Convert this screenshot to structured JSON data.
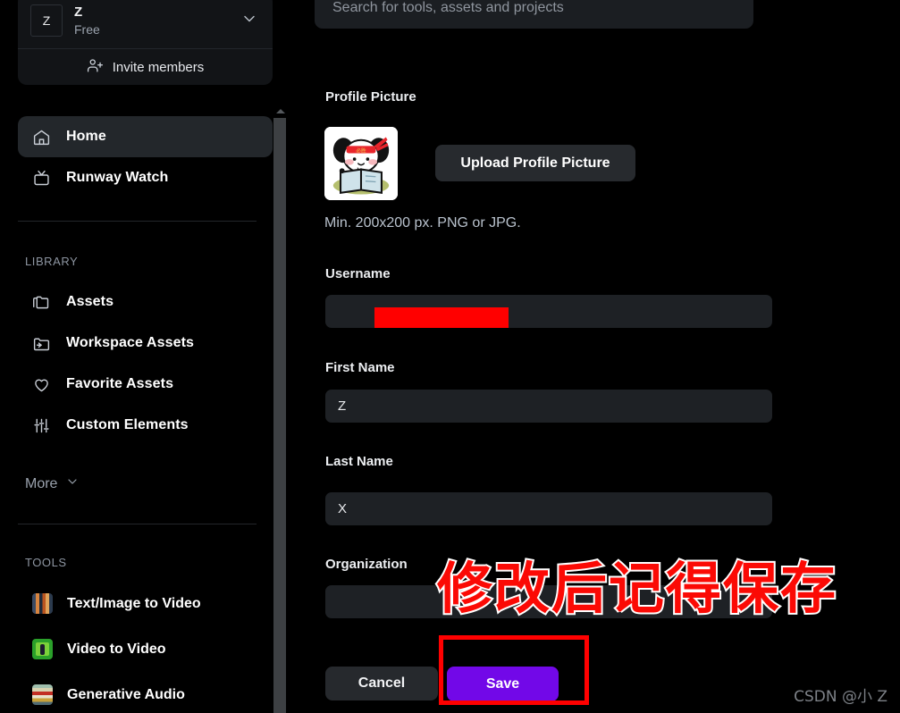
{
  "sidebar": {
    "workspace": {
      "avatar_initial": "Z",
      "name": "Z",
      "plan": "Free",
      "chevron_icon": "chevron-down-icon",
      "invite_label": "Invite members",
      "invite_icon": "user-plus-icon"
    },
    "nav": [
      {
        "label": "Home",
        "icon": "home-icon",
        "active": true
      },
      {
        "label": "Runway Watch",
        "icon": "tv-icon",
        "active": false
      }
    ],
    "library": {
      "heading": "LIBRARY",
      "items": [
        {
          "label": "Assets",
          "icon": "folders-icon"
        },
        {
          "label": "Workspace Assets",
          "icon": "folder-share-icon"
        },
        {
          "label": "Favorite Assets",
          "icon": "heart-icon"
        },
        {
          "label": "Custom Elements",
          "icon": "sliders-icon"
        }
      ],
      "more_label": "More",
      "more_icon": "chevron-down-icon"
    },
    "tools": {
      "heading": "TOOLS",
      "items": [
        {
          "label": "Text/Image to Video",
          "icon": "tool-thumbnail-text-image-to-video"
        },
        {
          "label": "Video to Video",
          "icon": "tool-thumbnail-video-to-video"
        },
        {
          "label": "Generative Audio",
          "icon": "tool-thumbnail-generative-audio"
        }
      ]
    },
    "scrollbar": {
      "up_arrow_icon": "scroll-up-arrow-icon"
    }
  },
  "search": {
    "placeholder": "Search for tools, assets and projects",
    "value": ""
  },
  "profile": {
    "picture_label": "Profile Picture",
    "avatar_icon": "dog-reading-book-avatar",
    "upload_button": "Upload Profile Picture",
    "requirements_note": "Min. 200x200 px. PNG or JPG.",
    "fields": [
      {
        "label": "Username",
        "value": "",
        "redacted": true
      },
      {
        "label": "First Name",
        "value": "Z",
        "redacted": false
      },
      {
        "label": "Last Name",
        "value": "X",
        "redacted": false
      },
      {
        "label": "Organization",
        "value": "",
        "redacted": false
      }
    ],
    "cancel_button": "Cancel",
    "save_button": "Save"
  },
  "annotations": {
    "callout_text": "修改后记得保存",
    "callout_color": "#fb0a05",
    "highlight_box_color": "#ff0000",
    "redaction_color": "#ff0000"
  },
  "watermark": "CSDN @小 Z",
  "colors": {
    "page_background": "#000000",
    "panel_background": "#121417",
    "input_background": "#1e2125",
    "accent_purple": "#7208e8",
    "nav_active": "#23272b"
  }
}
